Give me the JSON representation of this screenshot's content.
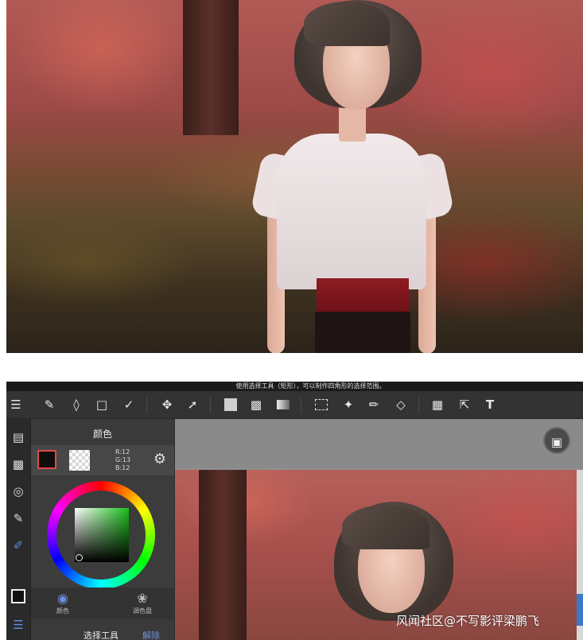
{
  "hint_text": "使用选择工具（矩形），可以制作四角形的选择范围。",
  "toolbar": {
    "icons": [
      "menu-icon",
      "brush-icon",
      "eraser-icon",
      "rectangle-icon",
      "pen-tool-icon",
      "move-icon",
      "transform-icon",
      "fill-square-icon",
      "bucket-icon",
      "gradient-icon",
      "select-rect-icon",
      "magic-wand-icon",
      "select-pen-icon",
      "select-eraser-icon",
      "layer-move-icon",
      "crop-icon",
      "text-icon"
    ]
  },
  "color_panel": {
    "title": "颜色",
    "rgb": [
      "R:12",
      "G:13",
      "B:12"
    ],
    "foreground_color": "#0c0d0c",
    "tabs": [
      "颜色",
      "调色盘"
    ]
  },
  "footer": {
    "tool_name": "选择工具",
    "action": "解除"
  },
  "watermark": "风闻社区@不写影评梁鹏飞"
}
